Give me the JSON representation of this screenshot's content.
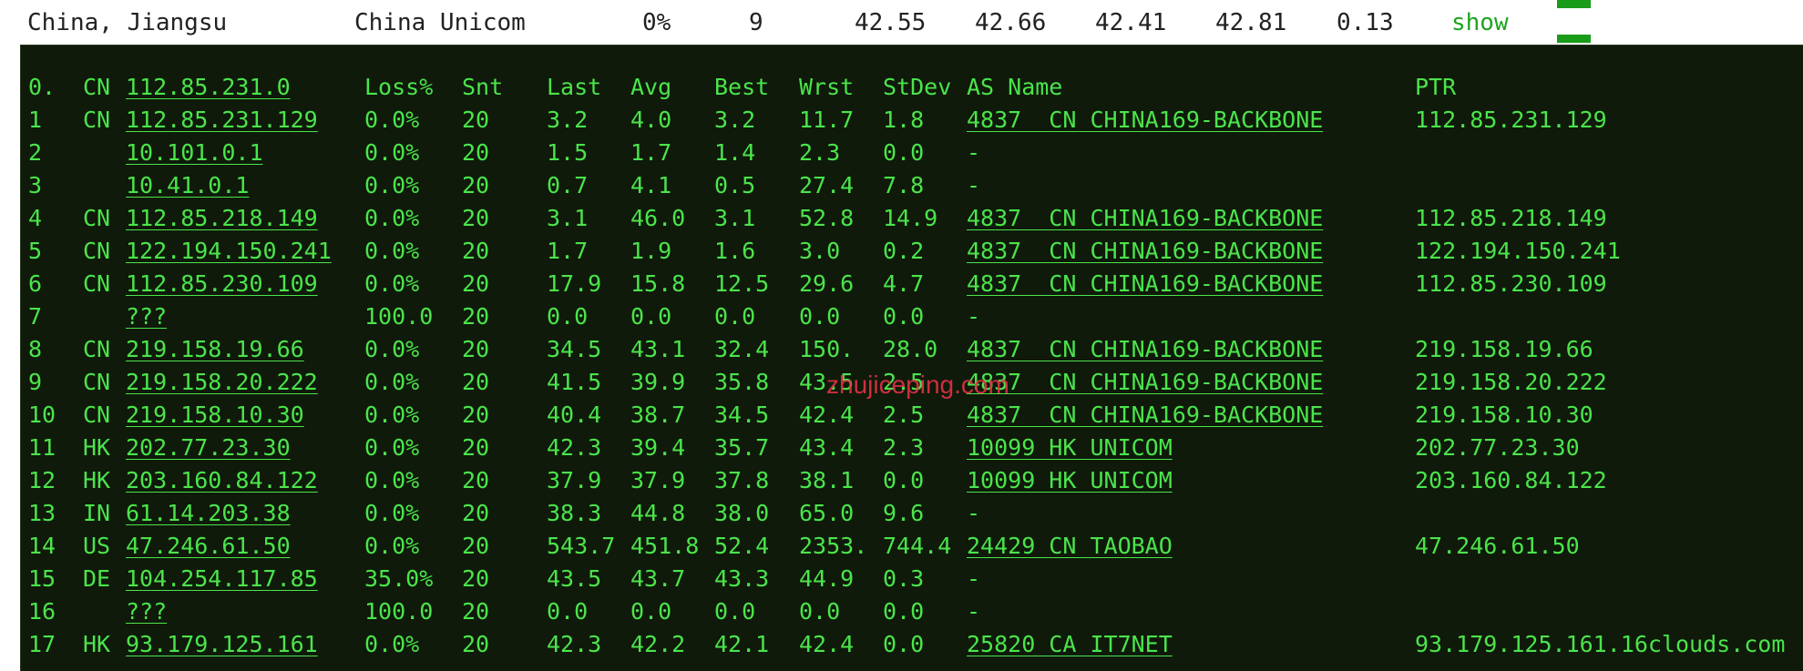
{
  "header": {
    "location": "China, Jiangsu",
    "isp": "China Unicom",
    "loss": "0%",
    "count": "9",
    "v1": "42.55",
    "v2": "42.66",
    "v3": "42.41",
    "v4": "42.81",
    "v5": "0.13",
    "show_label": "show"
  },
  "colors": {
    "terminal_bg": "#0f1a0a",
    "terminal_text": "#4be44b",
    "show_link": "#1fa31f",
    "corner_bar": "#1a9c1a",
    "watermark": "#e13246"
  },
  "watermark": "zhujiceping.com",
  "table": {
    "headers": {
      "hop": "0.",
      "cc": "CN",
      "host": "112.85.231.0",
      "loss": "Loss%",
      "snt": "Snt",
      "last": "Last",
      "avg": "Avg",
      "best": "Best",
      "wrst": "Wrst",
      "stdev": "StDev",
      "asname": "AS Name",
      "ptr": "PTR"
    },
    "rows": [
      {
        "hop": "1",
        "cc": "CN",
        "host": "112.85.231.129",
        "loss": "0.0%",
        "snt": "20",
        "last": "3.2",
        "avg": "4.0",
        "best": "3.2",
        "wrst": "11.7",
        "stdev": "1.8",
        "asname": "4837  CN CHINA169-BACKBONE",
        "ptr": "112.85.231.129"
      },
      {
        "hop": "2",
        "cc": "",
        "host": "10.101.0.1",
        "loss": "0.0%",
        "snt": "20",
        "last": "1.5",
        "avg": "1.7",
        "best": "1.4",
        "wrst": "2.3",
        "stdev": "0.0",
        "asname": "-",
        "ptr": ""
      },
      {
        "hop": "3",
        "cc": "",
        "host": "10.41.0.1",
        "loss": "0.0%",
        "snt": "20",
        "last": "0.7",
        "avg": "4.1",
        "best": "0.5",
        "wrst": "27.4",
        "stdev": "7.8",
        "asname": "-",
        "ptr": ""
      },
      {
        "hop": "4",
        "cc": "CN",
        "host": "112.85.218.149",
        "loss": "0.0%",
        "snt": "20",
        "last": "3.1",
        "avg": "46.0",
        "best": "3.1",
        "wrst": "52.8",
        "stdev": "14.9",
        "asname": "4837  CN CHINA169-BACKBONE",
        "ptr": "112.85.218.149"
      },
      {
        "hop": "5",
        "cc": "CN",
        "host": "122.194.150.241",
        "loss": "0.0%",
        "snt": "20",
        "last": "1.7",
        "avg": "1.9",
        "best": "1.6",
        "wrst": "3.0",
        "stdev": "0.2",
        "asname": "4837  CN CHINA169-BACKBONE",
        "ptr": "122.194.150.241"
      },
      {
        "hop": "6",
        "cc": "CN",
        "host": "112.85.230.109",
        "loss": "0.0%",
        "snt": "20",
        "last": "17.9",
        "avg": "15.8",
        "best": "12.5",
        "wrst": "29.6",
        "stdev": "4.7",
        "asname": "4837  CN CHINA169-BACKBONE",
        "ptr": "112.85.230.109"
      },
      {
        "hop": "7",
        "cc": "",
        "host": "???",
        "loss": "100.0",
        "snt": "20",
        "last": "0.0",
        "avg": "0.0",
        "best": "0.0",
        "wrst": "0.0",
        "stdev": "0.0",
        "asname": "-",
        "ptr": ""
      },
      {
        "hop": "8",
        "cc": "CN",
        "host": "219.158.19.66",
        "loss": "0.0%",
        "snt": "20",
        "last": "34.5",
        "avg": "43.1",
        "best": "32.4",
        "wrst": "150.",
        "stdev": "28.0",
        "asname": "4837  CN CHINA169-BACKBONE",
        "ptr": "219.158.19.66"
      },
      {
        "hop": "9",
        "cc": "CN",
        "host": "219.158.20.222",
        "loss": "0.0%",
        "snt": "20",
        "last": "41.5",
        "avg": "39.9",
        "best": "35.8",
        "wrst": "43.5",
        "stdev": "2.5",
        "asname": "4837  CN CHINA169-BACKBONE",
        "ptr": "219.158.20.222"
      },
      {
        "hop": "10",
        "cc": "CN",
        "host": "219.158.10.30",
        "loss": "0.0%",
        "snt": "20",
        "last": "40.4",
        "avg": "38.7",
        "best": "34.5",
        "wrst": "42.4",
        "stdev": "2.5",
        "asname": "4837  CN CHINA169-BACKBONE",
        "ptr": "219.158.10.30"
      },
      {
        "hop": "11",
        "cc": "HK",
        "host": "202.77.23.30",
        "loss": "0.0%",
        "snt": "20",
        "last": "42.3",
        "avg": "39.4",
        "best": "35.7",
        "wrst": "43.4",
        "stdev": "2.3",
        "asname": "10099 HK UNICOM",
        "ptr": "202.77.23.30"
      },
      {
        "hop": "12",
        "cc": "HK",
        "host": "203.160.84.122",
        "loss": "0.0%",
        "snt": "20",
        "last": "37.9",
        "avg": "37.9",
        "best": "37.8",
        "wrst": "38.1",
        "stdev": "0.0",
        "asname": "10099 HK UNICOM",
        "ptr": "203.160.84.122"
      },
      {
        "hop": "13",
        "cc": "IN",
        "host": "61.14.203.38",
        "loss": "0.0%",
        "snt": "20",
        "last": "38.3",
        "avg": "44.8",
        "best": "38.0",
        "wrst": "65.0",
        "stdev": "9.6",
        "asname": "-",
        "ptr": ""
      },
      {
        "hop": "14",
        "cc": "US",
        "host": "47.246.61.50",
        "loss": "0.0%",
        "snt": "20",
        "last": "543.7",
        "avg": "451.8",
        "best": "52.4",
        "wrst": "2353.",
        "stdev": "744.4",
        "asname": "24429 CN TAOBAO",
        "ptr": "47.246.61.50"
      },
      {
        "hop": "15",
        "cc": "DE",
        "host": "104.254.117.85",
        "loss": "35.0%",
        "snt": "20",
        "last": "43.5",
        "avg": "43.7",
        "best": "43.3",
        "wrst": "44.9",
        "stdev": "0.3",
        "asname": "-",
        "ptr": ""
      },
      {
        "hop": "16",
        "cc": "",
        "host": "???",
        "loss": "100.0",
        "snt": "20",
        "last": "0.0",
        "avg": "0.0",
        "best": "0.0",
        "wrst": "0.0",
        "stdev": "0.0",
        "asname": "-",
        "ptr": ""
      },
      {
        "hop": "17",
        "cc": "HK",
        "host": "93.179.125.161",
        "loss": "0.0%",
        "snt": "20",
        "last": "42.3",
        "avg": "42.2",
        "best": "42.1",
        "wrst": "42.4",
        "stdev": "0.0",
        "asname": "25820 CA IT7NET",
        "ptr": "93.179.125.161.16clouds.com"
      }
    ]
  }
}
